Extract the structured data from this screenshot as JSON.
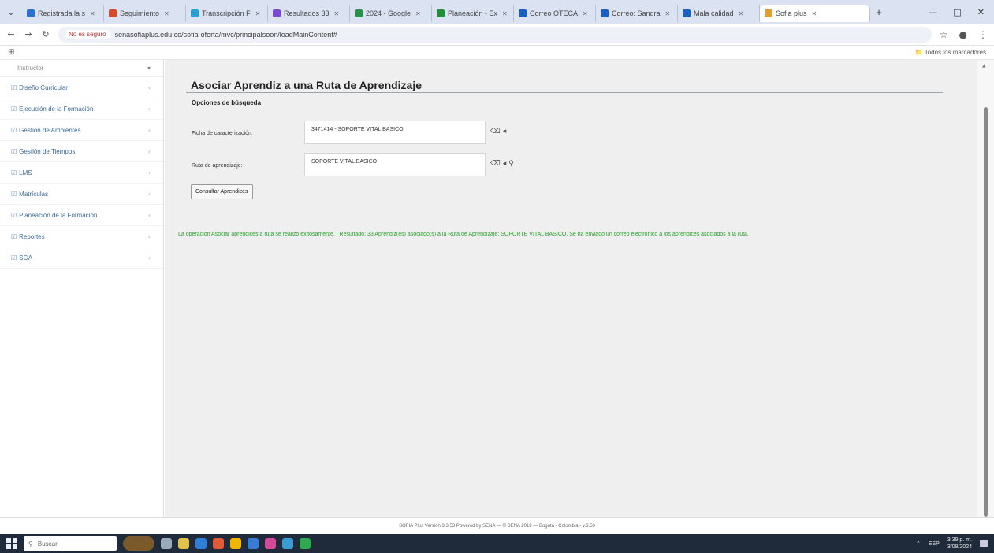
{
  "browser": {
    "tabs": [
      {
        "title": "Registrada la s",
        "color": "#2a6fd1"
      },
      {
        "title": "Seguimiento",
        "color": "#d14a2a"
      },
      {
        "title": "Transcripción F",
        "color": "#2a9fd1"
      },
      {
        "title": "Resultados 33",
        "color": "#7a4ad1"
      },
      {
        "title": "2024 - Google",
        "color": "#2a8f4a"
      },
      {
        "title": "Planeación - Ex",
        "color": "#1f8f3a"
      },
      {
        "title": "Correo OTECA",
        "color": "#1a5fc1"
      },
      {
        "title": "Correo: Sandra",
        "color": "#1a5fc1"
      },
      {
        "title": "Mala calidad",
        "color": "#1a5fc1"
      },
      {
        "title": "Sofia plus",
        "color": "#e0a030",
        "active": true
      }
    ],
    "window_controls": [
      "—",
      "□",
      "✕"
    ],
    "address": {
      "secure_label": "No es seguro",
      "url": "senasofiaplus.edu.co/sofia-oferta/mvc/principalsoon/loadMainContent#"
    },
    "bookmarks_label": "Todos los marcadores"
  },
  "sidebar": {
    "header": "Instructor",
    "items": [
      {
        "label": "Diseño Curricular"
      },
      {
        "label": "Ejecución de la Formación"
      },
      {
        "label": "Gestión de Ambientes"
      },
      {
        "label": "Gestión de Tiempos"
      },
      {
        "label": "LMS"
      },
      {
        "label": "Matrículas"
      },
      {
        "label": "Planeación de la Formación"
      },
      {
        "label": "Reportes"
      },
      {
        "label": "SGA"
      }
    ]
  },
  "main": {
    "title": "Asociar Aprendiz a una Ruta de Aprendizaje",
    "section_title": "Opciones de búsqueda",
    "ficha": {
      "label": "Ficha de caracterización:",
      "value": "3471414 - SOPORTE VITAL BASICO"
    },
    "ruta": {
      "label": "Ruta de aprendizaje:",
      "value": "SOPORTE VITAL BASICO"
    },
    "button_label": "Consultar Aprendices",
    "success_message": "La operación Asociar aprendices a ruta se realizó exitosamente. | Resultado: 33 Aprendiz(es) asociado(s) a la Ruta de Aprendizaje: SOPORTE VITAL BASICO. Se ha enviado un correo electrónico a los aprendices asociados a la ruta."
  },
  "footer": "SOFIA Plus Versión 3.3.53 Powered by SENA — © SENA 2019 — Bogotá - Colombia - v.3.53",
  "taskbar": {
    "search_placeholder": "Buscar",
    "clock_time": "3:39 p. m.",
    "clock_date": "3/08/2024",
    "lang": "ESP"
  }
}
